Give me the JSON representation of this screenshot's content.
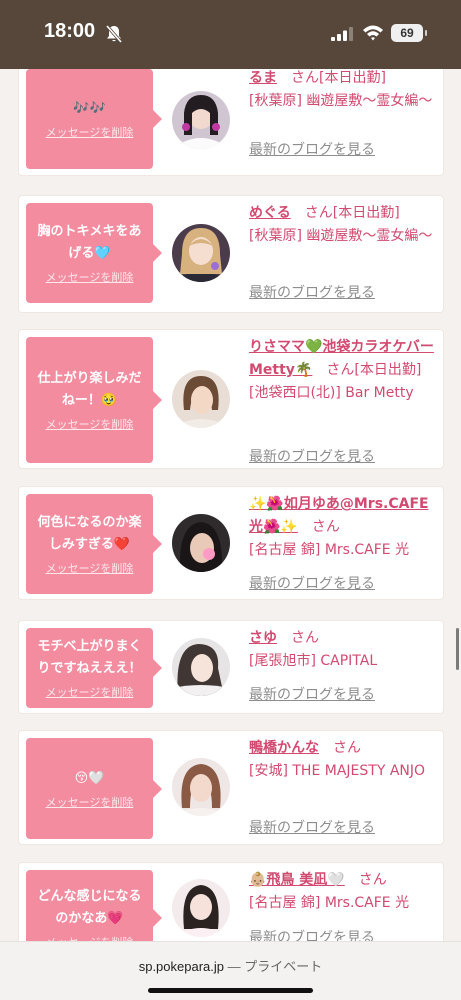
{
  "status": {
    "time": "18:00",
    "battery": "69"
  },
  "browser": {
    "domain": "sp.pokepara.jp",
    "separator": "—",
    "mode": "プライベート"
  },
  "ui": {
    "delete_label": "メッセージを削除",
    "san": "さん",
    "blog_label": "最新のブログを見る"
  },
  "cards": [
    {
      "message": "🎶🎶",
      "name": "るま",
      "status_suffix": "[本日出勤]",
      "shop": "[秋葉原] 幽遊屋敷〜霊女編〜"
    },
    {
      "message": "胸のトキメキをあげる🩵",
      "name": "めぐる",
      "status_suffix": "[本日出勤]",
      "shop": "[秋葉原] 幽遊屋敷〜霊女編〜"
    },
    {
      "message": "仕上がり楽しみだねー！🥹",
      "name": "りさママ💚池袋カラオケバーMetty🌴",
      "status_suffix": "[本日出勤]",
      "shop": "[池袋西口(北)] Bar Metty"
    },
    {
      "message": "何色になるのか楽しみすぎる❤️",
      "name": "✨🌺如月ゆあ@Mrs.CAFE光🌺✨",
      "status_suffix": "",
      "shop": "[名古屋 錦] Mrs.CAFE 光"
    },
    {
      "message": "モチベ上がりまくりですねえええ！",
      "name": "さゆ",
      "status_suffix": "",
      "shop": "[尾張旭市] CAPITAL"
    },
    {
      "message": "😚🤍",
      "name": "鴨橋かんな",
      "status_suffix": "",
      "shop": "[安城] THE MAJESTY ANJO"
    },
    {
      "message": "どんな感じになるのかなあ💗",
      "name": "👶🏼飛鳥 美凪🤍",
      "status_suffix": "",
      "shop": "[名古屋 錦] Mrs.CAFE 光"
    }
  ],
  "colors": {
    "status_bar": "#56473a",
    "bubble": "#f48ca0",
    "name": "#d24a70",
    "link_gray": "#8d8d8d"
  }
}
